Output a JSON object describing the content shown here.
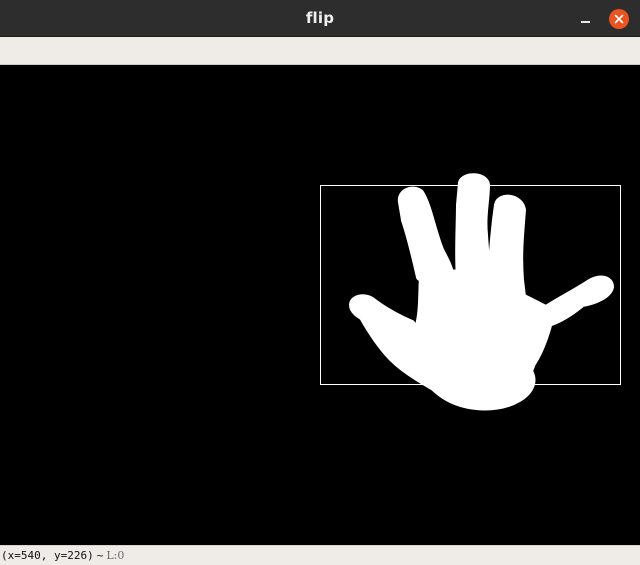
{
  "window": {
    "title": "flip"
  },
  "status": {
    "coords": "(x=540, y=226)",
    "separator": "~",
    "level": "L:0"
  }
}
